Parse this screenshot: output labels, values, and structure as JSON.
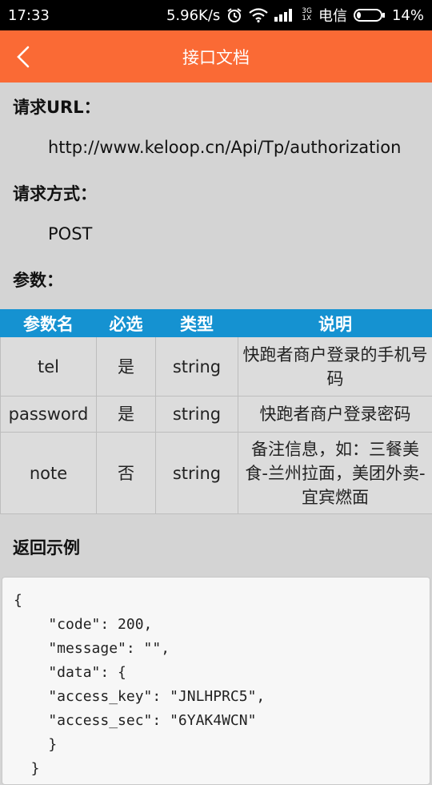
{
  "status_bar": {
    "time": "17:33",
    "speed": "5.96K/s",
    "net_sub_top": "3G",
    "net_sub_bottom": "1X",
    "carrier": "电信",
    "battery": "14%",
    "battery_level": 0.14
  },
  "header": {
    "title": "接口文档"
  },
  "request": {
    "url_label": "请求URL：",
    "url": "http://www.keloop.cn/Api/Tp/authorization",
    "method_label": "请求方式：",
    "method": "POST",
    "params_label": "参数："
  },
  "params_table": {
    "headers": [
      "参数名",
      "必选",
      "类型",
      "说明"
    ],
    "rows": [
      [
        "tel",
        "是",
        "string",
        "快跑者商户登录的手机号码"
      ],
      [
        "password",
        "是",
        "string",
        "快跑者商户登录密码"
      ],
      [
        "note",
        "否",
        "string",
        "备注信息，如：三餐美食-兰州拉面，美团外卖-宜宾燃面"
      ]
    ]
  },
  "response": {
    "label": "返回示例",
    "code": "{\n    \"code\": 200,\n    \"message\": \"\",\n    \"data\": {\n    \"access_key\": \"JNLHPRC5\",\n    \"access_sec\": \"6YAK4WCN\"\n    }\n  }"
  },
  "colors": {
    "header": "#fa6a35",
    "table_header": "#1592d1",
    "background": "#d4d4d4"
  }
}
